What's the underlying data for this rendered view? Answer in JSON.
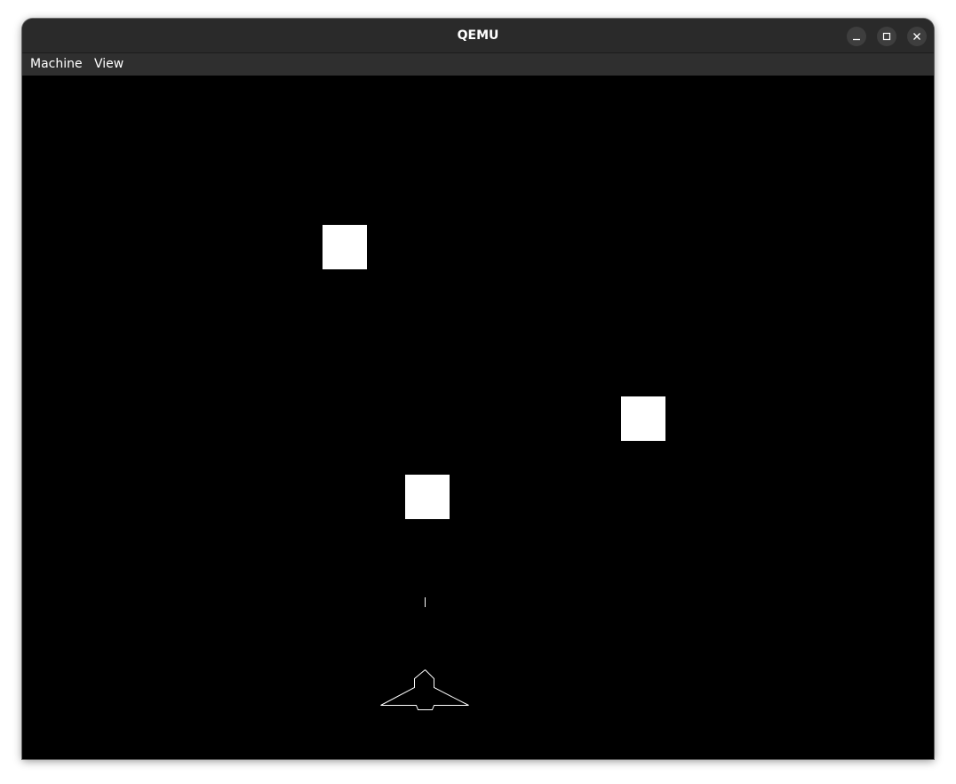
{
  "window": {
    "title": "QEMU",
    "buttons": {
      "minimize_icon": "minimize-icon",
      "maximize_icon": "maximize-icon",
      "close_icon": "close-icon"
    }
  },
  "menubar": {
    "items": [
      {
        "label": "Machine"
      },
      {
        "label": "View"
      }
    ]
  },
  "game": {
    "background": "#000000",
    "foreground": "#ffffff",
    "enemies_visible": 3,
    "projectiles_visible": 1
  }
}
